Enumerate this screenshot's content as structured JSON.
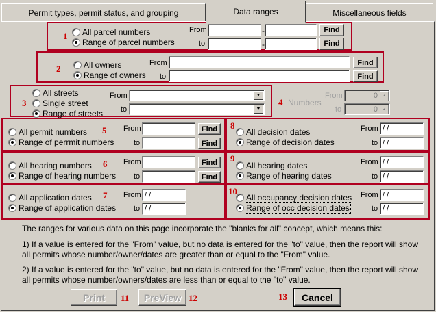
{
  "tabs": [
    {
      "label": "Permit types, permit status, and grouping",
      "active": false
    },
    {
      "label": "Data ranges",
      "active": true
    },
    {
      "label": "Miscellaneous fields",
      "active": false
    }
  ],
  "common": {
    "from": "From",
    "to": "to",
    "find": "Find",
    "dash": "-",
    "date_placeholder": " / /"
  },
  "markers": [
    "1",
    "2",
    "3",
    "4",
    "5",
    "6",
    "7",
    "8",
    "9",
    "10",
    "11",
    "12",
    "13"
  ],
  "parcel": {
    "opt_all": "All parcel numbers",
    "opt_range": "Range of parcel numbers",
    "selected": "range"
  },
  "owners": {
    "opt_all": "All owners",
    "opt_range": "Range of owners",
    "selected": "range"
  },
  "streets": {
    "opt_all": "All streets",
    "opt_single": "Single street",
    "opt_range": "Range of streets",
    "selected": "range"
  },
  "numbers": {
    "label": "Numbers",
    "from_value": "0",
    "to_value": "0"
  },
  "permit_numbers": {
    "opt_all": "All permit numbers",
    "opt_range": "Range of perrmit numbers",
    "selected": "range"
  },
  "hearing_numbers": {
    "opt_all": "All hearing numbers",
    "opt_range": "Range of hearing numbers",
    "selected": "range"
  },
  "application_dates": {
    "opt_all": "All application dates",
    "opt_range": "Range of application dates",
    "selected": "range",
    "from_value": " / /",
    "to_value": " / /"
  },
  "decision_dates": {
    "opt_all": "All decision dates",
    "opt_range": "Range of decision dates",
    "selected": "range",
    "from_value": " / /",
    "to_value": " / /"
  },
  "hearing_dates": {
    "opt_all": "All hearing dates",
    "opt_range": "Range of hearing dates",
    "selected": "range",
    "from_value": " / /",
    "to_value": " / /"
  },
  "occupancy_dates": {
    "opt_all": "All occupancy decision dates",
    "opt_range": "Range of occ decision dates",
    "selected": "range",
    "from_value": " / /",
    "to_value": " / /"
  },
  "info": {
    "intro": "The ranges for various data on this page incorporate the \"blanks for all\" concept, which means this:",
    "rule1": "1) If a value is entered for the \"From\" value, but no data is entered for the \"to\" value, then the report will show all permits whose number/owner/dates are greater than or equal to the \"From\" value.",
    "rule2": "2) If a value is entered for the \"to\" value, but no data is entered for the \"From\" value, then the report will show all permits whose number/owners/dates are less than or equal to the \"to\" value."
  },
  "buttons": {
    "print": "Print",
    "preview": "PreView",
    "cancel": "Cancel"
  }
}
